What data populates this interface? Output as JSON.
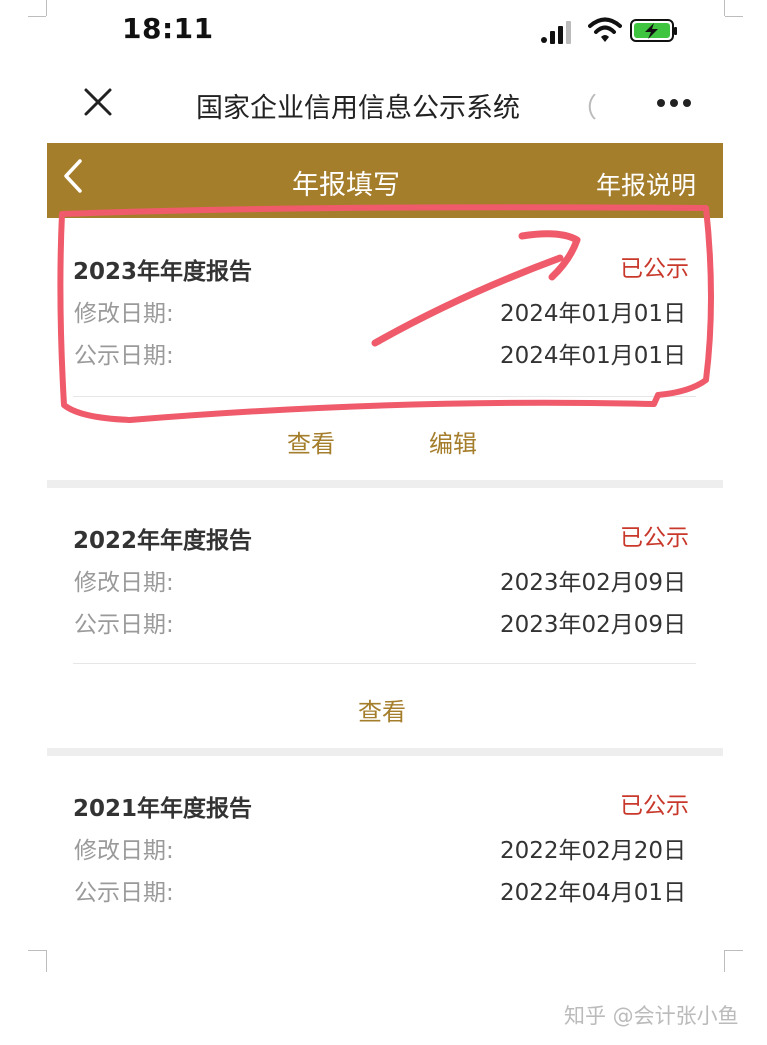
{
  "status_bar": {
    "time": "18:11"
  },
  "nav": {
    "title": "国家企业信用信息公示系统",
    "paren": "（"
  },
  "header": {
    "title": "年报填写",
    "right_link": "年报说明"
  },
  "reports": [
    {
      "title": "2023年年度报告",
      "status": "已公示",
      "modified_label": "修改日期:",
      "modified_date": "2024年01月01日",
      "published_label": "公示日期:",
      "published_date": "2024年01月01日",
      "actions": [
        "查看",
        "编辑"
      ]
    },
    {
      "title": "2022年年度报告",
      "status": "已公示",
      "modified_label": "修改日期:",
      "modified_date": "2023年02月09日",
      "published_label": "公示日期:",
      "published_date": "2023年02月09日",
      "actions": [
        "查看"
      ]
    },
    {
      "title": "2021年年度报告",
      "status": "已公示",
      "modified_label": "修改日期:",
      "modified_date": "2022年02月20日",
      "published_label": "公示日期:",
      "published_date": "2022年04月01日",
      "actions": []
    }
  ],
  "watermark": "知乎 @会计张小鱼",
  "colors": {
    "header_gold": "#a57e2c",
    "status_red": "#c8382b",
    "annotation_red": "#ef5b6a"
  }
}
